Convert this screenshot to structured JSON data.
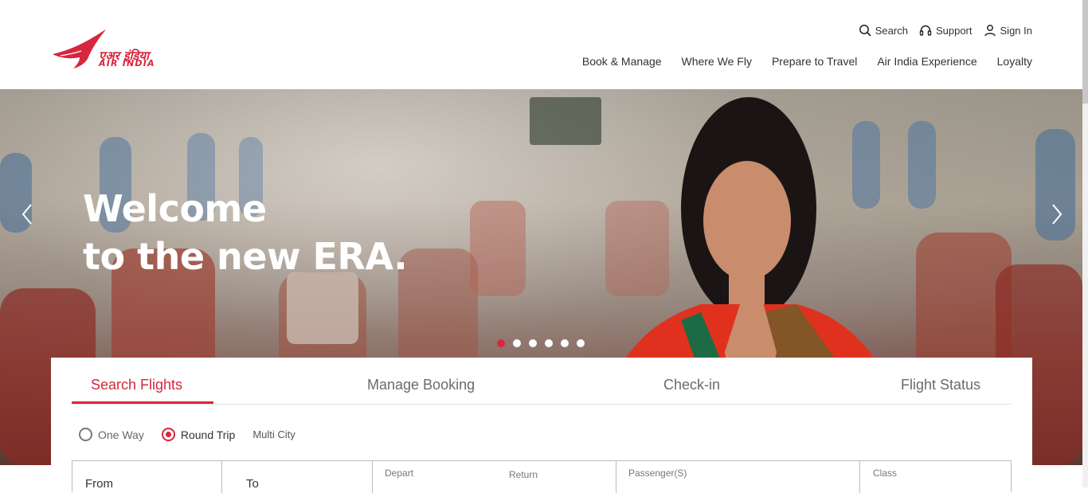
{
  "brand": {
    "hindi": "एअर इंडिया",
    "english": "AIR INDIA",
    "color": "#d7263d"
  },
  "utility": {
    "search": "Search",
    "support": "Support",
    "signin": "Sign In"
  },
  "nav": [
    "Book & Manage",
    "Where We Fly",
    "Prepare to Travel",
    "Air India Experience",
    "Loyalty"
  ],
  "hero": {
    "line1": "Welcome",
    "line2": "to the new ERA.",
    "slides": 6,
    "active_slide": 1
  },
  "tabs": [
    "Search Flights",
    "Manage Booking",
    "Check-in",
    "Flight Status"
  ],
  "trip": {
    "one_way": "One Way",
    "round_trip": "Round Trip",
    "multi_city": "Multi City",
    "selected": "Round Trip"
  },
  "fields": {
    "from": "From",
    "to": "To",
    "depart": "Depart",
    "return": "Return",
    "passengers": "Passenger(S)",
    "class": "Class"
  }
}
